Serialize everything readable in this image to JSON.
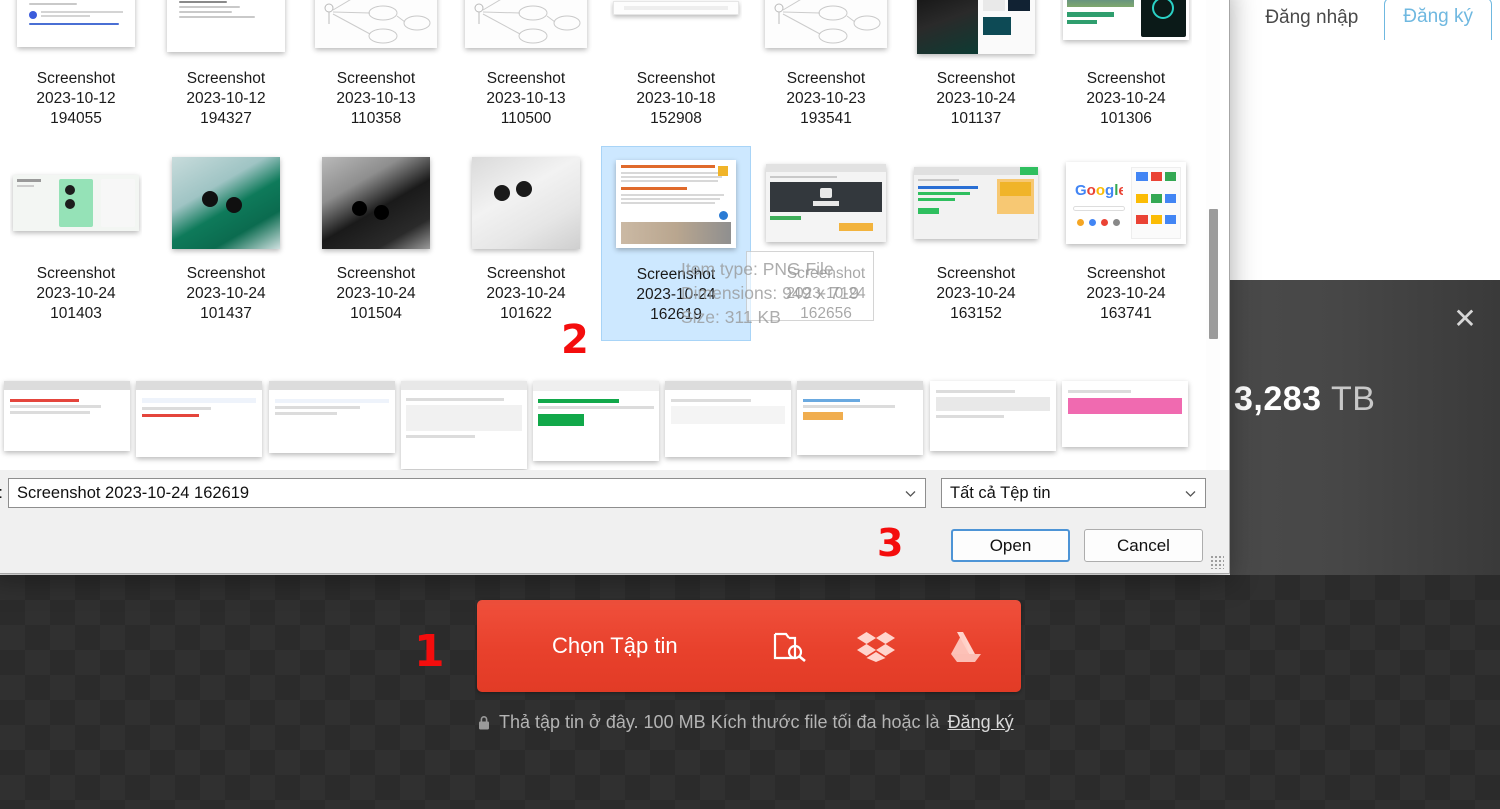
{
  "page": {
    "auth": {
      "login_label": "Đăng nhập",
      "signup_label": "Đăng ký"
    },
    "uploader": {
      "choose_file_label": "Chọn Tập tin",
      "drop_hint_prefix": "Thả tập tin ở đây. 100 MB Kích thước file tối đa hoặc là ",
      "drop_hint_link": "Đăng ký",
      "storage_number": "3,283",
      "storage_unit": "TB",
      "accent_color": "#e8412c"
    },
    "annotations": [
      {
        "id": "1",
        "label": "1"
      },
      {
        "id": "2",
        "label": "2"
      },
      {
        "id": "3",
        "label": "3"
      }
    ]
  },
  "dialog": {
    "filename_label": ":",
    "filename_value": "Screenshot 2023-10-24 162619",
    "filetype_value": "Tất cả Tệp tin",
    "open_label": "Open",
    "cancel_label": "Cancel",
    "tooltip": {
      "line1": "Item type: PNG File",
      "line2": "Dimensions: 949 x 719",
      "line3": "Size: 311 KB"
    },
    "files": [
      {
        "name_line1": "Screenshot",
        "name_line2": "2023-10-12",
        "name_line3": "194055",
        "thumb": "doc-text",
        "selected": false
      },
      {
        "name_line1": "Screenshot",
        "name_line2": "2023-10-12",
        "name_line3": "194327",
        "thumb": "doc-list",
        "selected": false
      },
      {
        "name_line1": "Screenshot",
        "name_line2": "2023-10-13",
        "name_line3": "110358",
        "thumb": "diagram",
        "selected": false
      },
      {
        "name_line1": "Screenshot",
        "name_line2": "2023-10-13",
        "name_line3": "110500",
        "thumb": "diagram",
        "selected": false
      },
      {
        "name_line1": "Screenshot",
        "name_line2": "2023-10-18",
        "name_line3": "152908",
        "thumb": "blank-wide",
        "selected": false
      },
      {
        "name_line1": "Screenshot",
        "name_line2": "2023-10-23",
        "name_line3": "193541",
        "thumb": "diagram",
        "selected": false
      },
      {
        "name_line1": "Screenshot",
        "name_line2": "2023-10-24",
        "name_line3": "101137",
        "thumb": "photo-model",
        "selected": false
      },
      {
        "name_line1": "Screenshot",
        "name_line2": "2023-10-24",
        "name_line3": "101306",
        "thumb": "photo-specs",
        "selected": false
      },
      {
        "name_line1": "Screenshot",
        "name_line2": "2023-10-24",
        "name_line3": "101403",
        "thumb": "photo-green-flat",
        "selected": false
      },
      {
        "name_line1": "Screenshot",
        "name_line2": "2023-10-24",
        "name_line3": "101437",
        "thumb": "photo-green-hand",
        "selected": false
      },
      {
        "name_line1": "Screenshot",
        "name_line2": "2023-10-24",
        "name_line3": "101504",
        "thumb": "photo-black-hand",
        "selected": false
      },
      {
        "name_line1": "Screenshot",
        "name_line2": "2023-10-24",
        "name_line3": "101622",
        "thumb": "photo-white-hand",
        "selected": false
      },
      {
        "name_line1": "Screenshot",
        "name_line2": "2023-10-24",
        "name_line3": "162619",
        "thumb": "article",
        "selected": true
      },
      {
        "name_line1": "Screenshot",
        "name_line2": "2023-10-24",
        "name_line3": "162656",
        "thumb": "browser-dark",
        "selected": false
      },
      {
        "name_line1": "Screenshot",
        "name_line2": "2023-10-24",
        "name_line3": "163152",
        "thumb": "browser-form",
        "selected": false
      },
      {
        "name_line1": "Screenshot",
        "name_line2": "2023-10-24",
        "name_line3": "163741",
        "thumb": "google",
        "selected": false
      }
    ],
    "files_row3": [
      {
        "thumb": "dlg-small"
      },
      {
        "thumb": "dlg-search"
      },
      {
        "thumb": "dlg-settings"
      },
      {
        "thumb": "dlg-panel"
      },
      {
        "thumb": "docs-editor"
      },
      {
        "thumb": "green-page"
      },
      {
        "thumb": "browser-light"
      },
      {
        "thumb": "chart-page"
      },
      {
        "thumb": "pink-page"
      }
    ]
  }
}
